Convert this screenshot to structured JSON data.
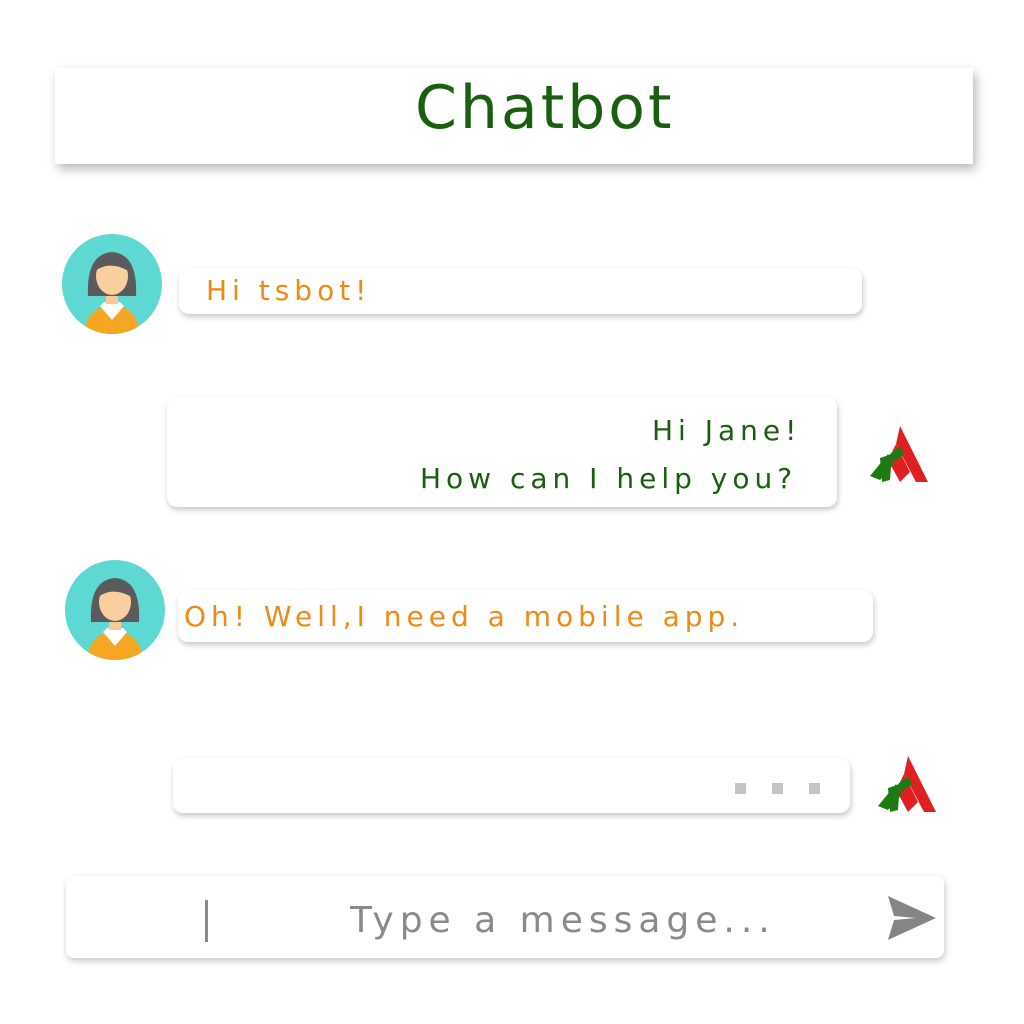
{
  "header": {
    "title": "Chatbot"
  },
  "colors": {
    "title": "#1b5e10",
    "user_text": "#f08a16",
    "bot_text": "#1b5e10",
    "avatar_bg": "#5ed8d2",
    "avatar_shirt": "#f5a623",
    "bot_logo_green": "#1e7b14",
    "bot_logo_red": "#e02020",
    "typing_dots": "#c4c4c4",
    "input_text": "#8a8a8a"
  },
  "messages": [
    {
      "sender": "user",
      "avatar_icon": "woman-avatar-icon",
      "lines": [
        "Hi tsbot!"
      ]
    },
    {
      "sender": "bot",
      "avatar_icon": "bot-logo-icon",
      "lines": [
        "Hi Jane!",
        "How can I help you?"
      ]
    },
    {
      "sender": "user",
      "avatar_icon": "woman-avatar-icon",
      "lines": [
        "Oh! Well,I need a mobile app."
      ]
    },
    {
      "sender": "bot",
      "avatar_icon": "bot-logo-icon",
      "typing": true,
      "lines": []
    }
  ],
  "composer": {
    "placeholder": "Type a message...",
    "value": "",
    "send_icon": "send-icon"
  }
}
